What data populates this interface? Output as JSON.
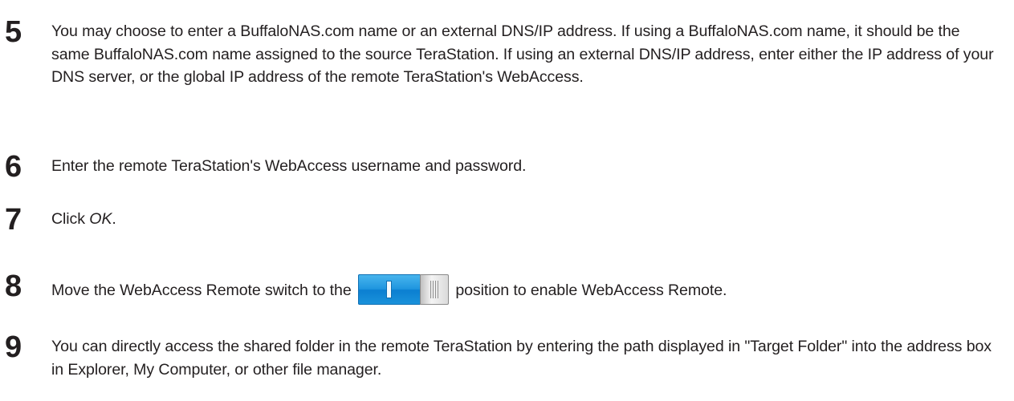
{
  "steps": [
    {
      "number": "5",
      "text": "You may choose to enter a BuffaloNAS.com name or an external DNS/IP address. If using a BuffaloNAS.com name, it should be the same BuffaloNAS.com name assigned to the source TeraStation. If using an external DNS/IP address, enter either the IP address of your DNS server, or the global IP address of the remote TeraStation's WebAccess."
    },
    {
      "number": "6",
      "text": "Enter the remote TeraStation's WebAccess username and password."
    },
    {
      "number": "7",
      "text_before": "Click ",
      "emphasis": "OK",
      "text_after": "."
    },
    {
      "number": "8",
      "text_before": "Move the WebAccess Remote switch to the ",
      "text_after": " position to enable WebAccess Remote.",
      "switch_state": "on",
      "switch_icon": "toggle-switch-on-icon",
      "switch_colors": {
        "track": "#1f96df",
        "knob": "#d9d9d9"
      }
    },
    {
      "number": "9",
      "text": "You can directly access the shared folder in the remote TeraStation by entering the path displayed in \"Target Folder\" into the address box in Explorer, My Computer, or other file manager."
    }
  ]
}
